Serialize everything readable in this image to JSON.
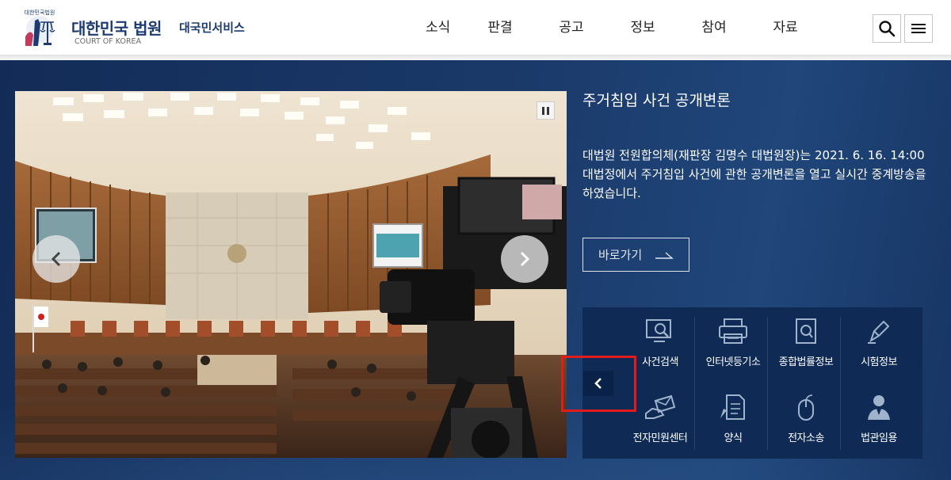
{
  "header": {
    "logo_seal_text": "대한민국법원",
    "logo_title": "대한민국 법원",
    "logo_subtitle": "COURT OF KOREA",
    "service_name": "대국민서비스",
    "nav": [
      "소식",
      "판결",
      "공고",
      "정보",
      "참여",
      "자료"
    ],
    "search_icon": "search-icon",
    "menu_icon": "hamburger-menu-icon"
  },
  "slide": {
    "title": "주거침입 사건 공개변론",
    "description": "대법원 전원합의체(재판장 김명수 대법원장)는 2021. 6. 16. 14:00 대법정에서 주거침입 사건에 관한 공개변론을 열고 실시간 중계방송을 하였습니다.",
    "go_label": "바로가기",
    "image_alt": "대법정 공개변론 사진"
  },
  "quick_services": [
    {
      "label": "사건검색",
      "icon": "magnifier-monitor-icon"
    },
    {
      "label": "인터넷등기소",
      "icon": "printer-icon"
    },
    {
      "label": "종합법률정보",
      "icon": "law-book-search-icon"
    },
    {
      "label": "시험정보",
      "icon": "pen-nib-icon"
    },
    {
      "label": "전자민원센터",
      "icon": "hand-envelope-icon"
    },
    {
      "label": "양식",
      "icon": "document-pen-icon"
    },
    {
      "label": "전자소송",
      "icon": "mouse-icon"
    },
    {
      "label": "법관임용",
      "icon": "judge-person-icon"
    }
  ],
  "colors": {
    "brand_navy": "#1d3b72",
    "visual_bg": "#1a3969",
    "quick_panel_bg": "#0f2b55",
    "highlight_red": "#e21b1b"
  }
}
